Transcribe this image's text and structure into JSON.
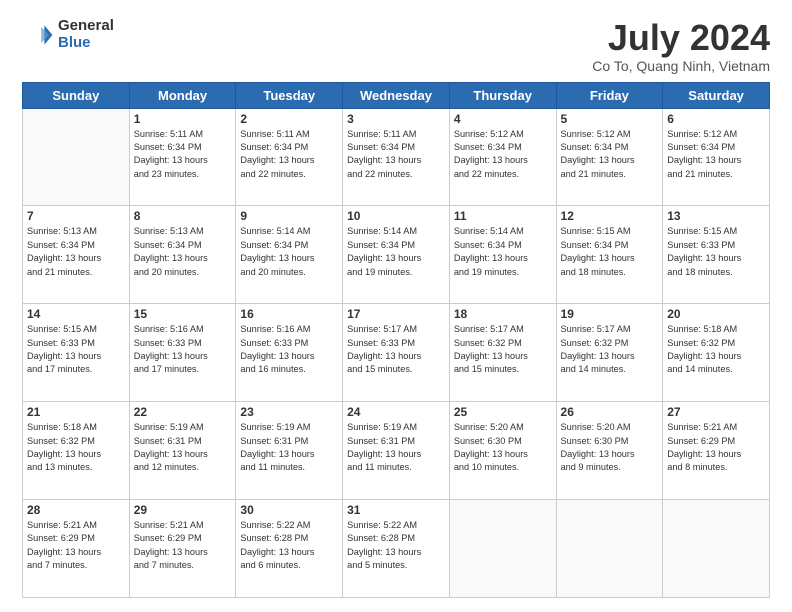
{
  "header": {
    "logo_general": "General",
    "logo_blue": "Blue",
    "title": "July 2024",
    "location": "Co To, Quang Ninh, Vietnam"
  },
  "days_of_week": [
    "Sunday",
    "Monday",
    "Tuesday",
    "Wednesday",
    "Thursday",
    "Friday",
    "Saturday"
  ],
  "weeks": [
    [
      {
        "day": "",
        "info": ""
      },
      {
        "day": "1",
        "info": "Sunrise: 5:11 AM\nSunset: 6:34 PM\nDaylight: 13 hours\nand 23 minutes."
      },
      {
        "day": "2",
        "info": "Sunrise: 5:11 AM\nSunset: 6:34 PM\nDaylight: 13 hours\nand 22 minutes."
      },
      {
        "day": "3",
        "info": "Sunrise: 5:11 AM\nSunset: 6:34 PM\nDaylight: 13 hours\nand 22 minutes."
      },
      {
        "day": "4",
        "info": "Sunrise: 5:12 AM\nSunset: 6:34 PM\nDaylight: 13 hours\nand 22 minutes."
      },
      {
        "day": "5",
        "info": "Sunrise: 5:12 AM\nSunset: 6:34 PM\nDaylight: 13 hours\nand 21 minutes."
      },
      {
        "day": "6",
        "info": "Sunrise: 5:12 AM\nSunset: 6:34 PM\nDaylight: 13 hours\nand 21 minutes."
      }
    ],
    [
      {
        "day": "7",
        "info": "Sunrise: 5:13 AM\nSunset: 6:34 PM\nDaylight: 13 hours\nand 21 minutes."
      },
      {
        "day": "8",
        "info": "Sunrise: 5:13 AM\nSunset: 6:34 PM\nDaylight: 13 hours\nand 20 minutes."
      },
      {
        "day": "9",
        "info": "Sunrise: 5:14 AM\nSunset: 6:34 PM\nDaylight: 13 hours\nand 20 minutes."
      },
      {
        "day": "10",
        "info": "Sunrise: 5:14 AM\nSunset: 6:34 PM\nDaylight: 13 hours\nand 19 minutes."
      },
      {
        "day": "11",
        "info": "Sunrise: 5:14 AM\nSunset: 6:34 PM\nDaylight: 13 hours\nand 19 minutes."
      },
      {
        "day": "12",
        "info": "Sunrise: 5:15 AM\nSunset: 6:34 PM\nDaylight: 13 hours\nand 18 minutes."
      },
      {
        "day": "13",
        "info": "Sunrise: 5:15 AM\nSunset: 6:33 PM\nDaylight: 13 hours\nand 18 minutes."
      }
    ],
    [
      {
        "day": "14",
        "info": "Sunrise: 5:15 AM\nSunset: 6:33 PM\nDaylight: 13 hours\nand 17 minutes."
      },
      {
        "day": "15",
        "info": "Sunrise: 5:16 AM\nSunset: 6:33 PM\nDaylight: 13 hours\nand 17 minutes."
      },
      {
        "day": "16",
        "info": "Sunrise: 5:16 AM\nSunset: 6:33 PM\nDaylight: 13 hours\nand 16 minutes."
      },
      {
        "day": "17",
        "info": "Sunrise: 5:17 AM\nSunset: 6:33 PM\nDaylight: 13 hours\nand 15 minutes."
      },
      {
        "day": "18",
        "info": "Sunrise: 5:17 AM\nSunset: 6:32 PM\nDaylight: 13 hours\nand 15 minutes."
      },
      {
        "day": "19",
        "info": "Sunrise: 5:17 AM\nSunset: 6:32 PM\nDaylight: 13 hours\nand 14 minutes."
      },
      {
        "day": "20",
        "info": "Sunrise: 5:18 AM\nSunset: 6:32 PM\nDaylight: 13 hours\nand 14 minutes."
      }
    ],
    [
      {
        "day": "21",
        "info": "Sunrise: 5:18 AM\nSunset: 6:32 PM\nDaylight: 13 hours\nand 13 minutes."
      },
      {
        "day": "22",
        "info": "Sunrise: 5:19 AM\nSunset: 6:31 PM\nDaylight: 13 hours\nand 12 minutes."
      },
      {
        "day": "23",
        "info": "Sunrise: 5:19 AM\nSunset: 6:31 PM\nDaylight: 13 hours\nand 11 minutes."
      },
      {
        "day": "24",
        "info": "Sunrise: 5:19 AM\nSunset: 6:31 PM\nDaylight: 13 hours\nand 11 minutes."
      },
      {
        "day": "25",
        "info": "Sunrise: 5:20 AM\nSunset: 6:30 PM\nDaylight: 13 hours\nand 10 minutes."
      },
      {
        "day": "26",
        "info": "Sunrise: 5:20 AM\nSunset: 6:30 PM\nDaylight: 13 hours\nand 9 minutes."
      },
      {
        "day": "27",
        "info": "Sunrise: 5:21 AM\nSunset: 6:29 PM\nDaylight: 13 hours\nand 8 minutes."
      }
    ],
    [
      {
        "day": "28",
        "info": "Sunrise: 5:21 AM\nSunset: 6:29 PM\nDaylight: 13 hours\nand 7 minutes."
      },
      {
        "day": "29",
        "info": "Sunrise: 5:21 AM\nSunset: 6:29 PM\nDaylight: 13 hours\nand 7 minutes."
      },
      {
        "day": "30",
        "info": "Sunrise: 5:22 AM\nSunset: 6:28 PM\nDaylight: 13 hours\nand 6 minutes."
      },
      {
        "day": "31",
        "info": "Sunrise: 5:22 AM\nSunset: 6:28 PM\nDaylight: 13 hours\nand 5 minutes."
      },
      {
        "day": "",
        "info": ""
      },
      {
        "day": "",
        "info": ""
      },
      {
        "day": "",
        "info": ""
      }
    ]
  ]
}
